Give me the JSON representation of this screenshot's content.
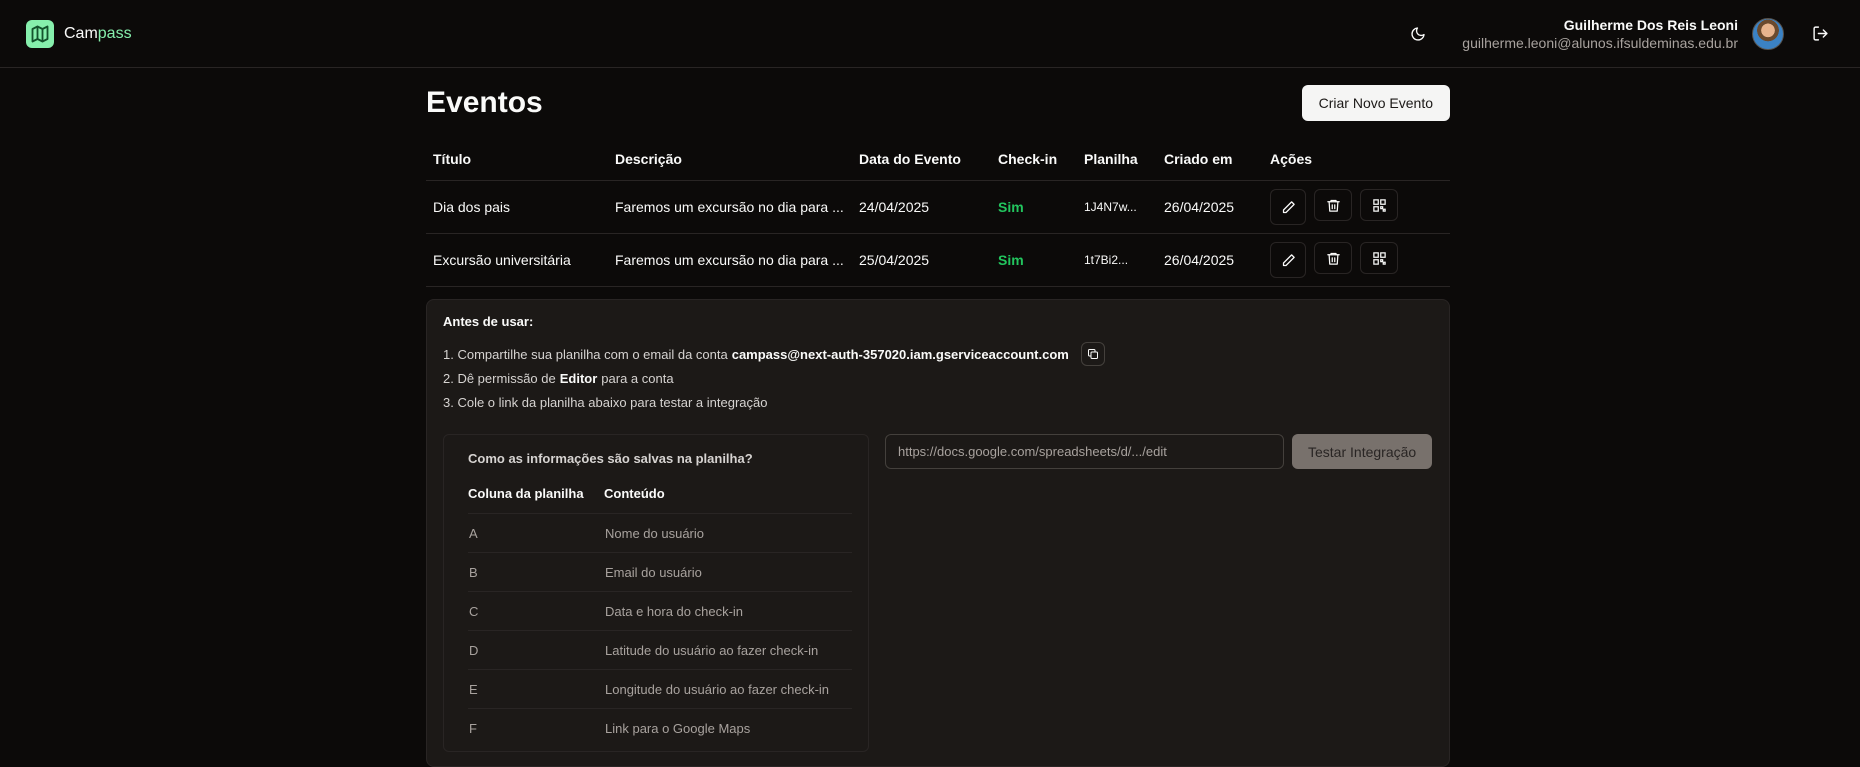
{
  "app": {
    "name_part1": "Cam",
    "name_part2": "pass"
  },
  "user": {
    "name": "Guilherme Dos Reis Leoni",
    "email": "guilherme.leoni@alunos.ifsuldeminas.edu.br"
  },
  "page": {
    "title": "Eventos",
    "create_button": "Criar Novo Evento"
  },
  "events_table": {
    "headers": [
      "Título",
      "Descrição",
      "Data do Evento",
      "Check-in",
      "Planilha",
      "Criado em",
      "Ações"
    ],
    "rows": [
      {
        "title": "Dia dos pais",
        "description": "Faremos um excursão no dia para ...",
        "date": "24/04/2025",
        "checkin": "Sim",
        "sheet": "1J4N7w...",
        "created": "26/04/2025"
      },
      {
        "title": "Excursão universitária",
        "description": "Faremos um excursão no dia para ...",
        "date": "25/04/2025",
        "checkin": "Sim",
        "sheet": "1t7Bi2...",
        "created": "26/04/2025"
      }
    ]
  },
  "instructions": {
    "title": "Antes de usar:",
    "step1_prefix": "1. Compartilhe sua planilha com o email da conta",
    "service_email": "campass@next-auth-357020.iam.gserviceaccount.com",
    "step2_prefix": "2. Dê permissão de",
    "step2_bold": "Editor",
    "step2_suffix": "para a conta",
    "step3": "3. Cole o link da planilha abaixo para testar a integração"
  },
  "columns_info": {
    "title": "Como as informações são salvas na planilha?",
    "headers": [
      "Coluna da planilha",
      "Conteúdo"
    ],
    "rows": [
      {
        "col": "A",
        "content": "Nome do usuário"
      },
      {
        "col": "B",
        "content": "Email do usuário"
      },
      {
        "col": "C",
        "content": "Data e hora do check-in"
      },
      {
        "col": "D",
        "content": "Latitude do usuário ao fazer check-in"
      },
      {
        "col": "E",
        "content": "Longitude do usuário ao fazer check-in"
      },
      {
        "col": "F",
        "content": "Link para o Google Maps"
      }
    ]
  },
  "integration": {
    "placeholder": "https://docs.google.com/spreadsheets/d/.../edit",
    "test_button": "Testar Integração"
  },
  "colors": {
    "accent": "#86efac",
    "success": "#22c55e",
    "background": "#0c0a09",
    "panel": "#1c1917"
  },
  "icons": [
    "map-logo-icon",
    "moon-icon",
    "logout-icon",
    "pencil-icon",
    "trash-icon",
    "qr-code-icon",
    "copy-icon"
  ]
}
